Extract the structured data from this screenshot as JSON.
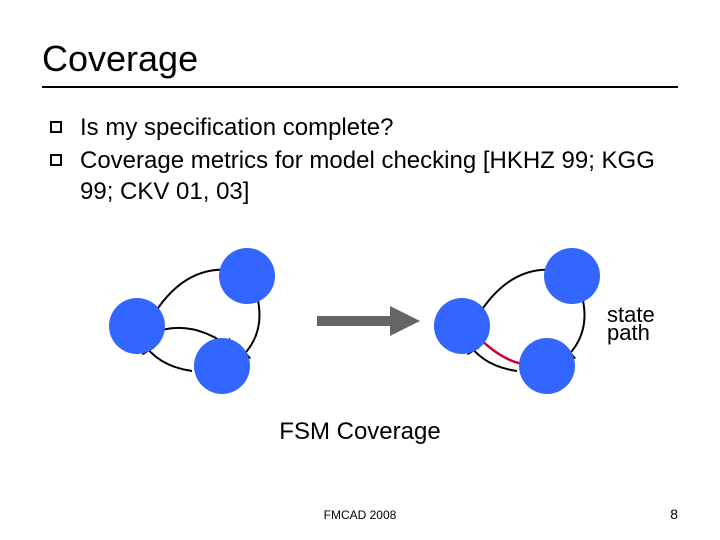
{
  "title": "Coverage",
  "bullets": [
    "Is my specification complete?",
    "Coverage metrics for model checking [HKHZ 99; KGG 99; CKV 01, 03]"
  ],
  "diagram": {
    "label_top": "state",
    "label_bottom": "path",
    "caption": "FSM Coverage",
    "colors": {
      "node": "#3366ff",
      "edge": "#000000",
      "highlight_edge": "#cc0033"
    }
  },
  "footer": "FMCAD 2008",
  "page_number": "8"
}
